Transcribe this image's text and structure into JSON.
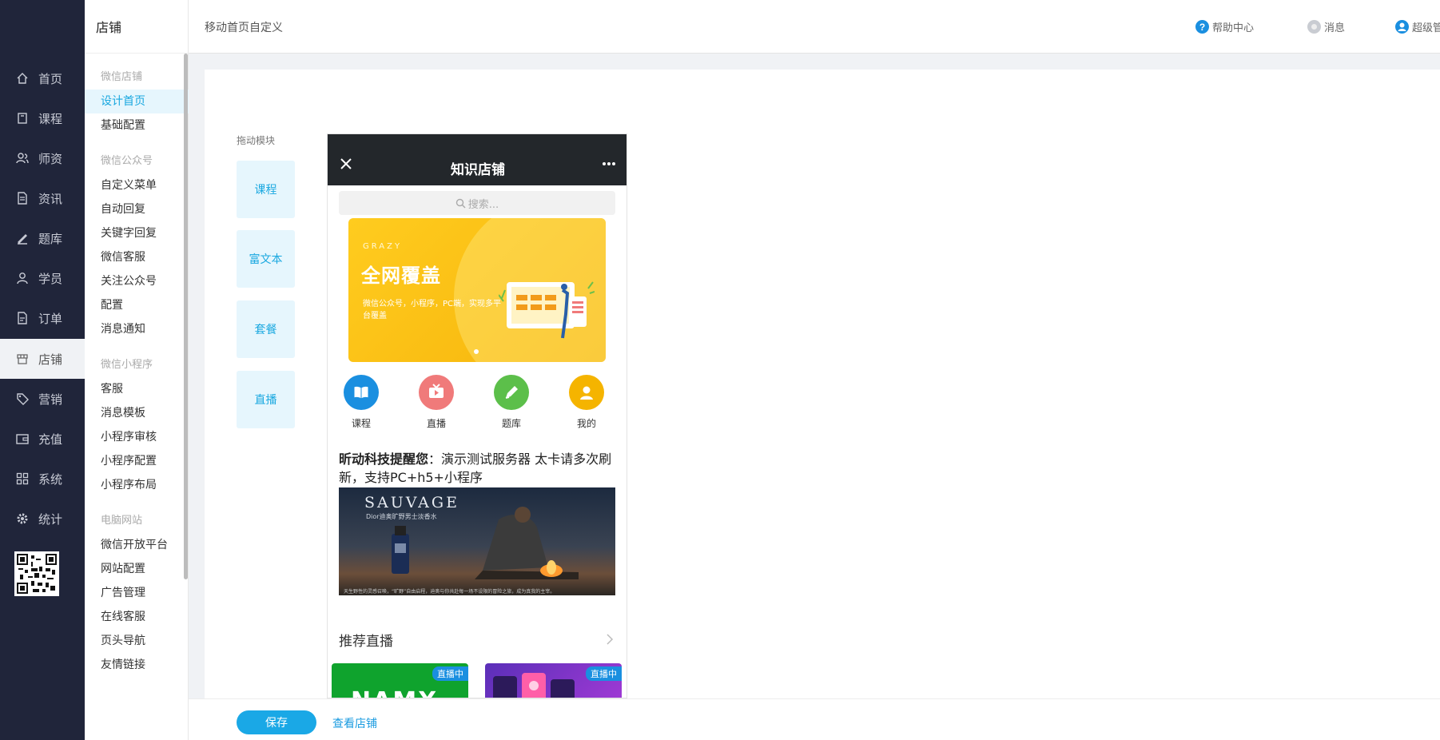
{
  "nav": {
    "items": [
      {
        "label": "首页",
        "icon": "home-icon"
      },
      {
        "label": "课程",
        "icon": "book-icon"
      },
      {
        "label": "师资",
        "icon": "teacher-icon"
      },
      {
        "label": "资讯",
        "icon": "news-icon"
      },
      {
        "label": "题库",
        "icon": "pen-icon"
      },
      {
        "label": "学员",
        "icon": "user-icon"
      },
      {
        "label": "订单",
        "icon": "order-icon"
      },
      {
        "label": "店铺",
        "icon": "store-icon"
      },
      {
        "label": "营销",
        "icon": "tag-icon"
      },
      {
        "label": "充值",
        "icon": "wallet-icon"
      },
      {
        "label": "系统",
        "icon": "grid-icon"
      },
      {
        "label": "统计",
        "icon": "gear-icon"
      }
    ],
    "active_index": 7
  },
  "submenu": {
    "title": "店铺",
    "groups": [
      {
        "title": "微信店铺",
        "items": [
          "设计首页",
          "基础配置"
        ]
      },
      {
        "title": "微信公众号",
        "items": [
          "自定义菜单",
          "自动回复",
          "关键字回复",
          "微信客服",
          "关注公众号",
          "配置",
          "消息通知"
        ]
      },
      {
        "title": "微信小程序",
        "items": [
          "客服",
          "消息模板",
          "小程序审核",
          "小程序配置",
          "小程序布局"
        ]
      },
      {
        "title": "电脑网站",
        "items": [
          "微信开放平台",
          "网站配置",
          "广告管理",
          "在线客服",
          "页头导航",
          "友情链接"
        ]
      }
    ],
    "active_item": "设计首页"
  },
  "header": {
    "breadcrumb": "移动首页自定义",
    "help": "帮助中心",
    "message": "消息",
    "admin": "超级管"
  },
  "modules": {
    "title": "拖动模块",
    "items": [
      "课程",
      "富文本",
      "套餐",
      "直播"
    ]
  },
  "phone": {
    "title": "知识店铺",
    "search_placeholder": "搜索...",
    "banner": {
      "subtitle": "GRAZY",
      "headline": "全网覆盖",
      "desc": "微信公众号，小程序，PC端，实现多平台覆盖"
    },
    "quick_icons": [
      {
        "label": "课程",
        "color": "#1a8fe0",
        "icon": "book-open-icon"
      },
      {
        "label": "直播",
        "color": "#f07a7a",
        "icon": "tv-icon"
      },
      {
        "label": "题库",
        "color": "#5cbf4a",
        "icon": "pencil-icon"
      },
      {
        "label": "我的",
        "color": "#f5b400",
        "icon": "person-icon"
      }
    ],
    "notice": {
      "bold": "昕动科技提醒您",
      "text": "：演示测试服务器 太卡请多次刷新，支持PC+h5+小程序"
    },
    "ad": {
      "brand": "SAUVAGE",
      "tag": "Dior迪奥旷野男士淡香水",
      "foot": "天生野性的灵感召唤，“旷野”自由启程，迪奥与你共赴每一场不设限的冒险之旅，成为真我的主宰。"
    },
    "recommend_title": "推荐直播",
    "live_badge": "直播中",
    "live_cards": [
      {
        "logo": "NAMX"
      },
      {
        "logo": ""
      }
    ]
  },
  "bottom": {
    "save": "保存",
    "view": "查看店铺"
  },
  "colors": {
    "nav_bg": "#20253a",
    "accent": "#1aa8e6",
    "module_bg": "#e6f6fd"
  }
}
